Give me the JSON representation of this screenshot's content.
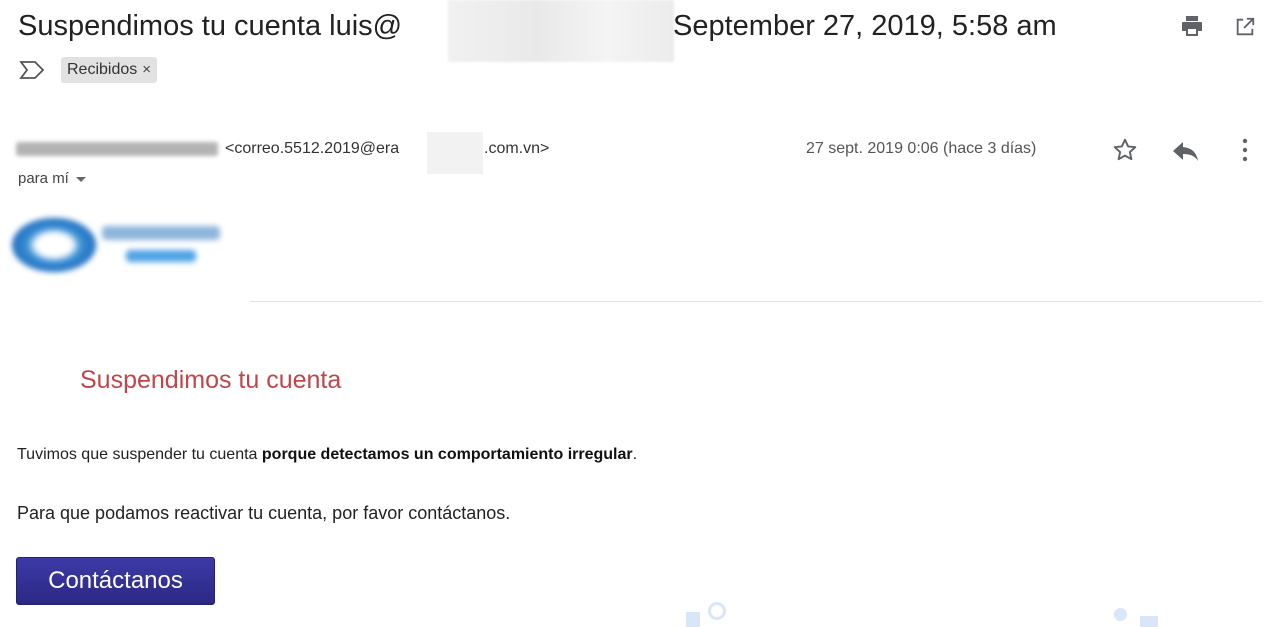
{
  "header": {
    "subject": "Suspendimos tu cuenta luis@",
    "date": "September 27, 2019, 5:58 am"
  },
  "labels": [
    {
      "name": "Recibidos",
      "remove": "×"
    }
  ],
  "sender": {
    "address_part1": "<correo.5512.2019@era",
    "address_part2": ".com.vn>",
    "received": "27 sept. 2019 0:06 (hace 3 días)",
    "recipient": "para mí"
  },
  "email_body": {
    "title": "Suspendimos tu cuenta",
    "para1_prefix": "Tuvimos que suspender tu cuenta ",
    "para1_bold": "porque detectamos un comportamiento irregular",
    "para1_suffix": ".",
    "para2": "Para que podamos reactivar tu cuenta, por favor contáctanos.",
    "cta": "Contáctanos"
  },
  "colors": {
    "title_red": "#c0464a",
    "cta_blue": "#2f2c94"
  },
  "icons": [
    "print-icon",
    "open-in-new-window-icon",
    "label-icon",
    "star-icon",
    "reply-icon",
    "more-vert-icon"
  ]
}
